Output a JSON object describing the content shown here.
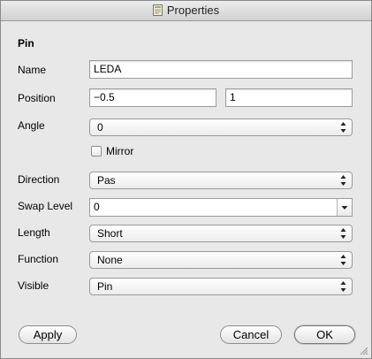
{
  "window": {
    "title": "Properties"
  },
  "section": {
    "title": "Pin"
  },
  "fields": {
    "name": {
      "label": "Name",
      "value": "LEDA"
    },
    "position": {
      "label": "Position",
      "x": "−0.5",
      "y": "1"
    },
    "angle": {
      "label": "Angle",
      "value": "0"
    },
    "mirror": {
      "label": "Mirror",
      "checked": false
    },
    "direction": {
      "label": "Direction",
      "value": "Pas"
    },
    "swap_level": {
      "label": "Swap Level",
      "value": "0"
    },
    "length": {
      "label": "Length",
      "value": "Short"
    },
    "function": {
      "label": "Function",
      "value": "None"
    },
    "visible": {
      "label": "Visible",
      "value": "Pin"
    }
  },
  "buttons": {
    "apply": "Apply",
    "cancel": "Cancel",
    "ok": "OK"
  },
  "icons": {
    "title": "document-icon",
    "popup": "up-down-arrows-icon",
    "combo": "chevron-down-icon",
    "resize": "resize-grip-icon"
  }
}
